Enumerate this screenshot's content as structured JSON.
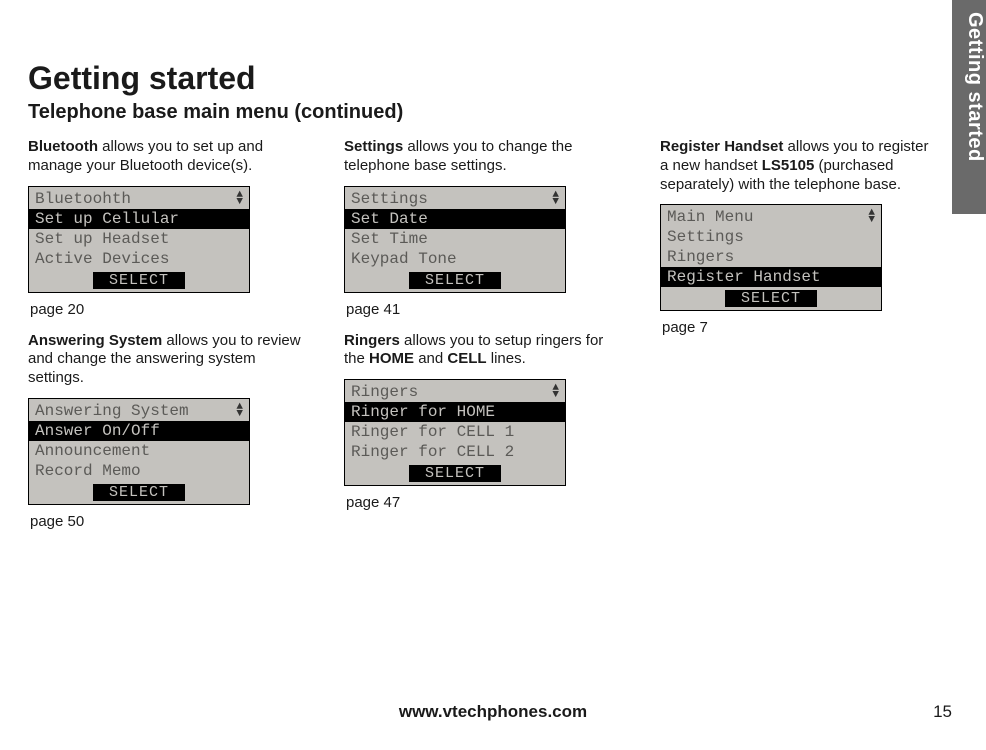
{
  "sidebar": {
    "label": "Getting started"
  },
  "heading": "Getting started",
  "subheading": "Telephone base main menu (continued)",
  "footer": {
    "url": "www.vtechphones.com",
    "page": "15"
  },
  "columns": [
    {
      "sections": [
        {
          "desc_lead": "Bluetooth",
          "desc_rest": " allows you to set up and manage your Bluetooth device(s).",
          "lcd": {
            "title": "Bluetoohth",
            "rows": [
              {
                "text": "Set up Cellular",
                "selected": true
              },
              {
                "text": "Set up Headset",
                "selected": false
              },
              {
                "text": "Active Devices",
                "selected": false
              }
            ],
            "softkey": "SELECT"
          },
          "pageref": "page 20"
        },
        {
          "desc_lead": "Answering System",
          "desc_rest": " allows you to review and change the answering system settings.",
          "lcd": {
            "title": "Answering System",
            "rows": [
              {
                "text": "Answer On/Off",
                "selected": true
              },
              {
                "text": "Announcement",
                "selected": false
              },
              {
                "text": "Record Memo",
                "selected": false
              }
            ],
            "softkey": "SELECT"
          },
          "pageref": "page 50"
        }
      ]
    },
    {
      "sections": [
        {
          "desc_lead": "Settings",
          "desc_rest": " allows you to change the telephone base settings.",
          "lcd": {
            "title": "Settings",
            "rows": [
              {
                "text": "Set Date",
                "selected": true
              },
              {
                "text": "Set Time",
                "selected": false
              },
              {
                "text": "Keypad Tone",
                "selected": false
              }
            ],
            "softkey": "SELECT"
          },
          "pageref": "page 41"
        },
        {
          "desc_html": "<b>Ringers</b> allows you to setup ringers for the <b>HOME</b> and <b>CELL</b> lines.",
          "lcd": {
            "title": "Ringers",
            "rows": [
              {
                "text": "Ringer for HOME",
                "selected": true
              },
              {
                "text": "Ringer for CELL 1",
                "selected": false
              },
              {
                "text": "Ringer for CELL 2",
                "selected": false
              }
            ],
            "softkey": "SELECT"
          },
          "pageref": "page 47"
        }
      ]
    },
    {
      "sections": [
        {
          "desc_html": "<b>Register Handset</b> allows you to register a new handset <b>LS5105</b> (purchased separately) with the telephone base.",
          "lcd": {
            "title": "Main Menu",
            "rows": [
              {
                "text": "Settings",
                "selected": false
              },
              {
                "text": "Ringers",
                "selected": false
              },
              {
                "text": "Register Handset",
                "selected": true
              }
            ],
            "softkey": "SELECT"
          },
          "pageref": "page 7"
        }
      ]
    }
  ]
}
